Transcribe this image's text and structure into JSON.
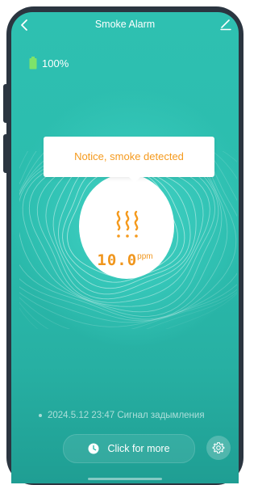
{
  "header": {
    "title": "Smoke Alarm",
    "back_icon": "chevron-left-icon",
    "edit_icon": "edit-icon"
  },
  "battery": {
    "icon": "battery-icon",
    "level_percent": 100,
    "text": "100%"
  },
  "alert": {
    "message": "Notice, smoke detected",
    "icon": "smoke-icon"
  },
  "reading": {
    "value": "10.0",
    "unit": "ppm"
  },
  "log": {
    "entry": "2024.5.12 23:47 Сигнал задымления"
  },
  "footer": {
    "more_label": "Click for more",
    "more_icon": "clock-icon",
    "settings_icon": "gear-icon"
  },
  "colors": {
    "background": "#2bbcad",
    "accent": "#f59a1d",
    "battery": "#7ee36a"
  }
}
